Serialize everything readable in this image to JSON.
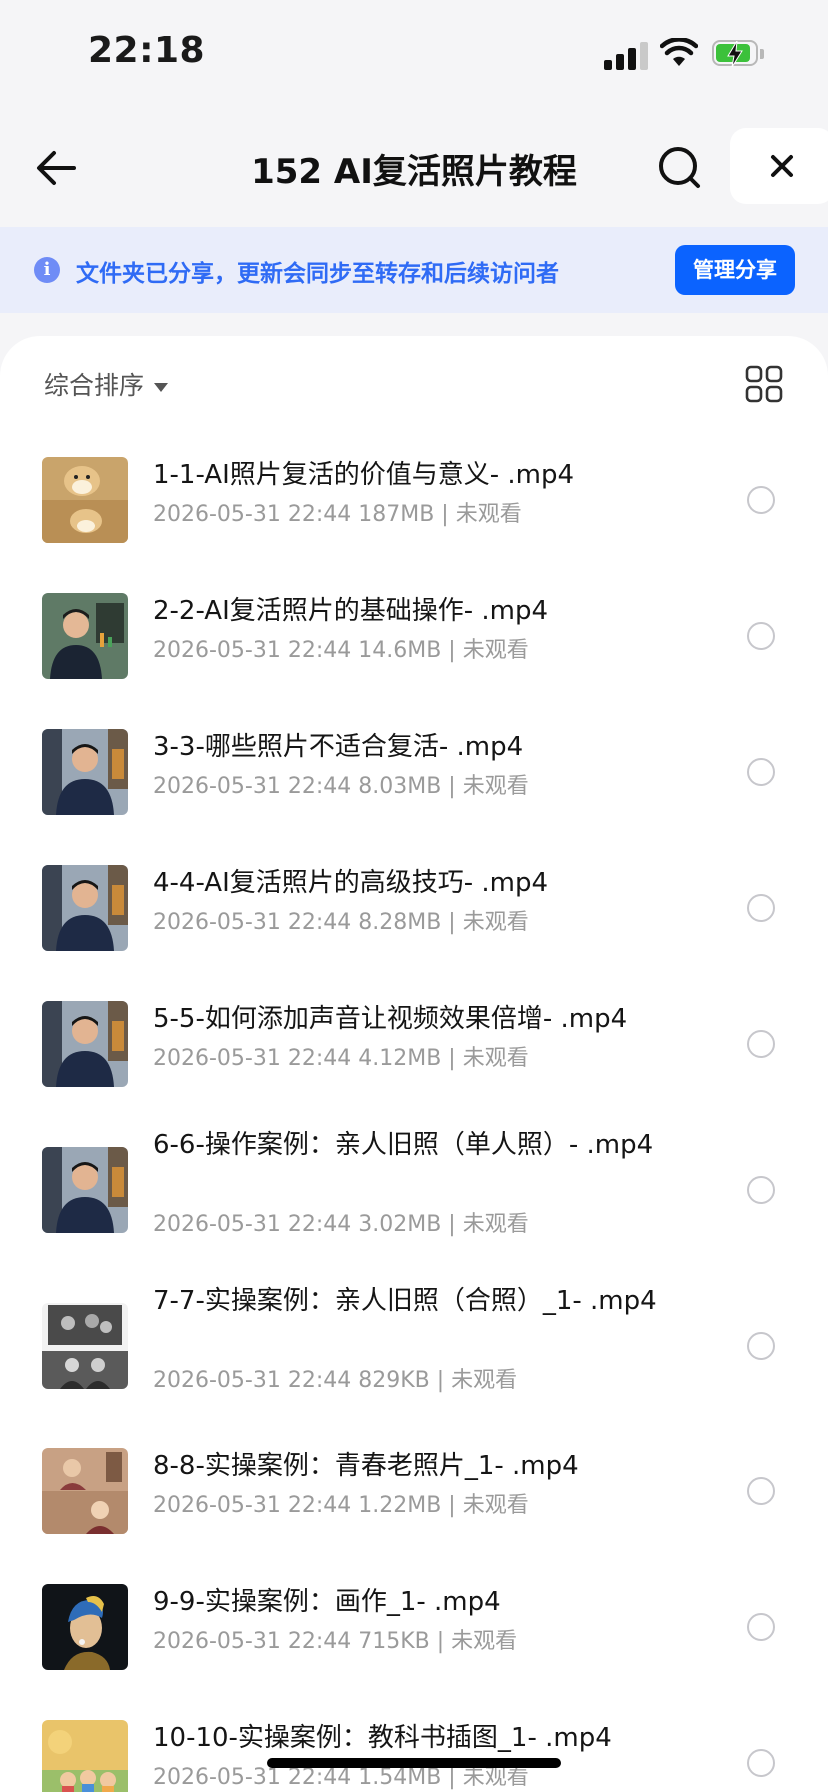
{
  "status": {
    "time": "22:18"
  },
  "nav": {
    "title": "152 AI复活照片教程"
  },
  "banner": {
    "info_glyph": "i",
    "text": "文件夹已分享，更新会同步至转存和后续访问者",
    "button": "管理分享"
  },
  "toolbar": {
    "sort_label": "综合排序"
  },
  "colors": {
    "accent": "#0b63ff",
    "banner_bg": "#e9edfb",
    "banner_text": "#2f6bf5",
    "meta_text": "#9a9a9a"
  },
  "files": [
    {
      "name": "1-1-AI照片复活的价值与意义- .mp4",
      "meta": "2026-05-31 22:44  187MB | 未观看",
      "thumb": "doge"
    },
    {
      "name": "2-2-AI复活照片的基础操作- .mp4",
      "meta": "2026-05-31 22:44  14.6MB | 未观看",
      "thumb": "presenter-green"
    },
    {
      "name": "3-3-哪些照片不适合复活- .mp4",
      "meta": "2026-05-31 22:44  8.03MB | 未观看",
      "thumb": "presenter"
    },
    {
      "name": "4-4-AI复活照片的高级技巧- .mp4",
      "meta": "2026-05-31 22:44  8.28MB | 未观看",
      "thumb": "presenter"
    },
    {
      "name": "5-5-如何添加声音让视频效果倍增- .mp4",
      "meta": "2026-05-31 22:44  4.12MB | 未观看",
      "thumb": "presenter"
    },
    {
      "name": "6-6-操作案例：亲人旧照（单人照）- .mp4",
      "meta": "2026-05-31 22:44  3.02MB | 未观看",
      "thumb": "presenter"
    },
    {
      "name": "7-7-实操案例：亲人旧照（合照）_1- .mp4",
      "meta": "2026-05-31 22:44  829KB | 未观看",
      "thumb": "old-photo"
    },
    {
      "name": "8-8-实操案例：青春老照片_1- .mp4",
      "meta": "2026-05-31 22:44  1.22MB | 未观看",
      "thumb": "vintage"
    },
    {
      "name": "9-9-实操案例：画作_1- .mp4",
      "meta": "2026-05-31 22:44  715KB | 未观看",
      "thumb": "painting"
    },
    {
      "name": "10-10-实操案例：教科书插图_1- .mp4",
      "meta": "2026-05-31 22:44  1.54MB | 未观看",
      "thumb": "illustration"
    }
  ]
}
